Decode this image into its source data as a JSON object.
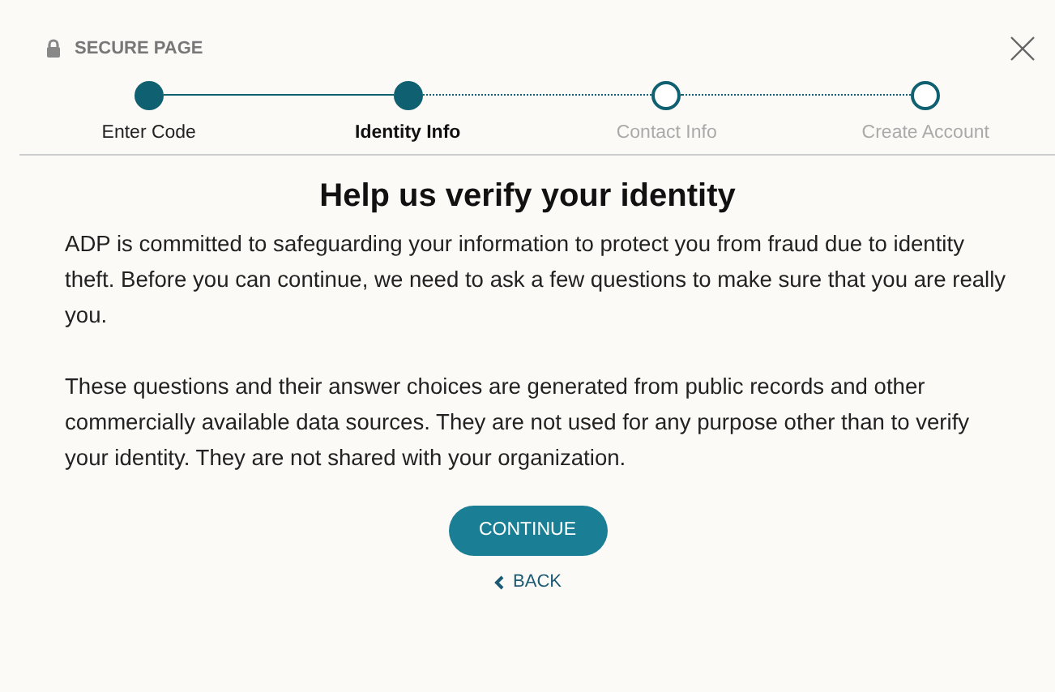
{
  "header": {
    "title": "SECURE PAGE"
  },
  "steps": [
    {
      "label": "Enter Code",
      "completed": true,
      "selected": false
    },
    {
      "label": "Identity Info",
      "completed": true,
      "selected": true
    },
    {
      "label": "Contact Info",
      "completed": false,
      "selected": false
    },
    {
      "label": "Create Account",
      "completed": false,
      "selected": false
    }
  ],
  "heading": "Help us verify your identity",
  "paragraphs": [
    "ADP is committed to safeguarding your information to protect you from fraud due to identity theft. Before you can continue, we need to ask a few questions to make sure that you are really you.",
    "These questions and their answer choices are generated from public records and other commercially available data sources. They are not used for any purpose other than to verify your identity. They are not shared with your organization."
  ],
  "primary_button": "CONTINUE",
  "back_link": "BACK"
}
